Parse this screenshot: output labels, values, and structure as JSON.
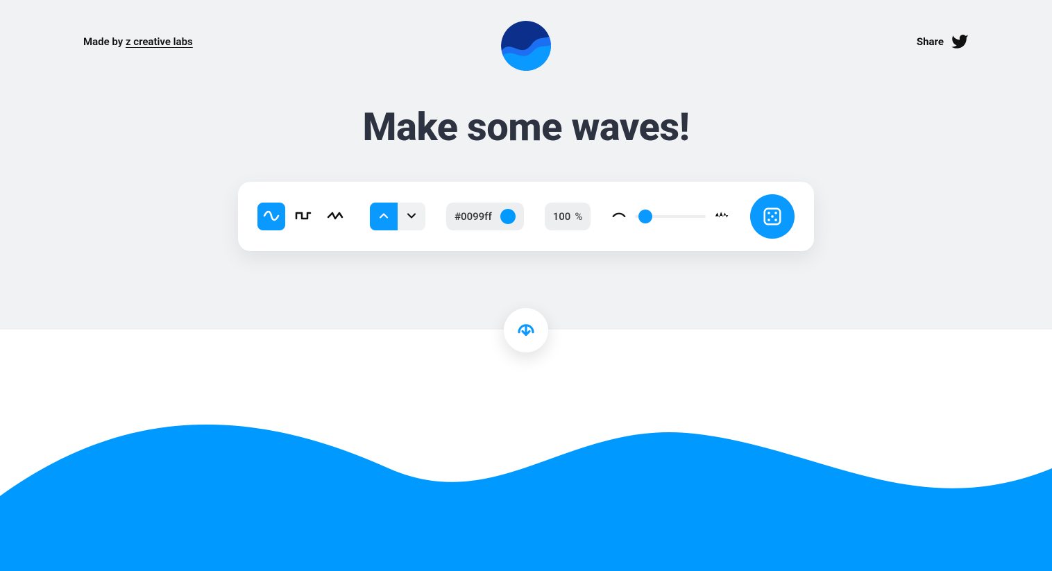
{
  "header": {
    "made_by_prefix": "Made by ",
    "made_by_link": "z creative labs",
    "share_label": "Share"
  },
  "title": "Make some waves!",
  "colors": {
    "accent": "#0a99ff",
    "swatch": "#0099ff",
    "logo_dark": "#0b2f8a",
    "logo_light": "#1b6ff0",
    "text_dark": "#2d3340"
  },
  "toolbar": {
    "wave_types": [
      {
        "id": "sine",
        "active": true
      },
      {
        "id": "square",
        "active": false
      },
      {
        "id": "peak",
        "active": false
      }
    ],
    "direction": [
      {
        "id": "up",
        "active": true
      },
      {
        "id": "down",
        "active": false
      }
    ],
    "color_hex": "#0099ff",
    "opacity_value": "100",
    "opacity_unit": "%",
    "complexity_slider_percent": 14
  }
}
